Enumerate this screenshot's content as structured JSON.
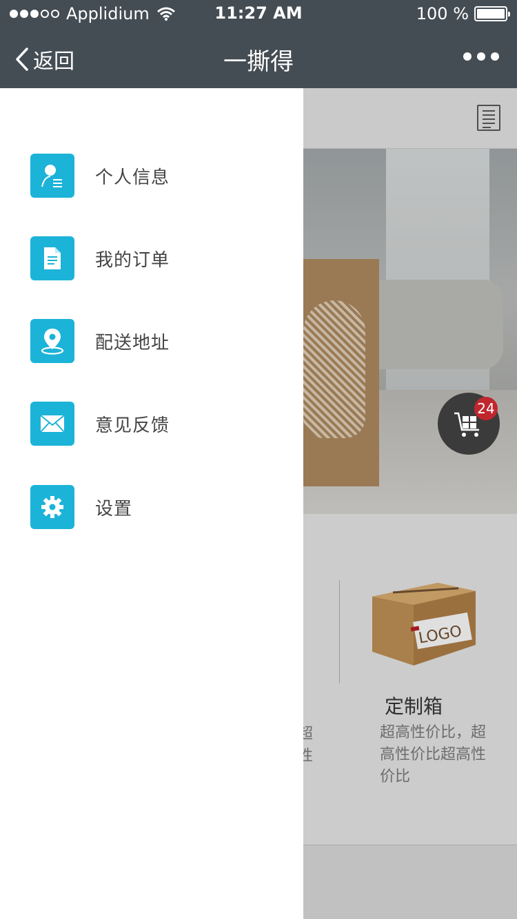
{
  "status_bar": {
    "carrier": "Applidium",
    "time": "11:27 AM",
    "battery": "100 %"
  },
  "nav": {
    "back_label": "返回",
    "title": "一撕得"
  },
  "drawer": {
    "items": [
      {
        "label": "个人信息",
        "icon": "user-profile-icon"
      },
      {
        "label": "我的订单",
        "icon": "document-icon"
      },
      {
        "label": "配送地址",
        "icon": "location-pin-icon"
      },
      {
        "label": "意见反馈",
        "icon": "envelope-icon"
      },
      {
        "label": "设置",
        "icon": "gear-icon"
      }
    ]
  },
  "cart": {
    "badge_count": "24"
  },
  "products": {
    "left_desc_fragment_1": "超",
    "left_desc_fragment_2": "性",
    "right": {
      "name": "定制箱",
      "description": "超高性价比，超高性价比超高性价比",
      "logo_text": "LOGO"
    }
  },
  "colors": {
    "nav_bg": "#454d54",
    "accent": "#1cb3d8",
    "badge": "#c0272d"
  }
}
